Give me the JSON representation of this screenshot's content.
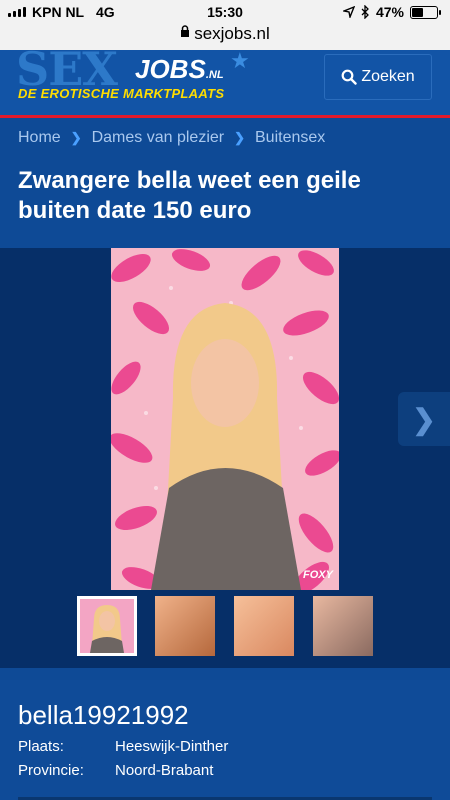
{
  "status_bar": {
    "carrier": "KPN NL",
    "network": "4G",
    "time": "15:30",
    "battery": "47%",
    "battery_level": 0.47,
    "icons": [
      "signal-bars-icon",
      "location-arrow-icon",
      "bluetooth-icon",
      "battery-icon"
    ]
  },
  "browser": {
    "url": "sexjobs.nl",
    "icon": "lock-icon"
  },
  "header": {
    "logo_main": "SEX",
    "logo_jobs": "JOBS",
    "logo_tld": ".NL",
    "logo_tagline": "DE EROTISCHE MARKTPLAATS",
    "search_label": "Zoeken",
    "search_icon": "search-icon",
    "accent_color": "#e21a2b",
    "brand_color": "#1254a6",
    "tagline_color": "#ffdd00"
  },
  "breadcrumb": {
    "items": [
      {
        "label": "Home"
      },
      {
        "label": "Dames van plezier"
      },
      {
        "label": "Buitensex"
      }
    ],
    "separator_icon": "chevron-right-icon"
  },
  "listing": {
    "title": "Zwangere bella weet een geile buiten date 150 euro"
  },
  "gallery": {
    "watermark": "FOXY",
    "next_icon": "chevron-right-icon",
    "thumbnails": [
      {
        "name": "thumbnail-1",
        "active": true
      },
      {
        "name": "thumbnail-2",
        "active": false
      },
      {
        "name": "thumbnail-3",
        "active": false
      },
      {
        "name": "thumbnail-4",
        "active": false
      }
    ]
  },
  "profile": {
    "username": "bella19921992",
    "fields": [
      {
        "label": "Plaats:",
        "value": "Heeswijk-Dinther"
      },
      {
        "label": "Provincie:",
        "value": "Noord-Brabant"
      }
    ]
  }
}
